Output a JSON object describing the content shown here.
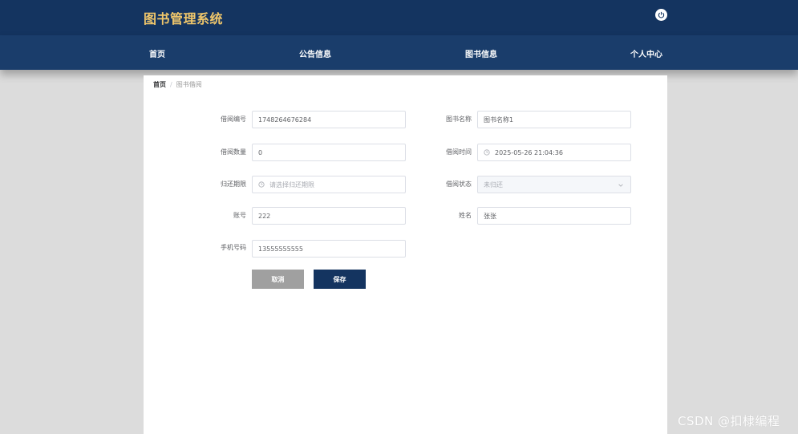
{
  "header": {
    "app_title": "图书管理系统"
  },
  "nav": {
    "items": [
      {
        "label": "首页"
      },
      {
        "label": "公告信息"
      },
      {
        "label": "图书信息"
      },
      {
        "label": "个人中心"
      }
    ]
  },
  "breadcrumb": {
    "home": "首页",
    "separator": "/",
    "current": "图书借阅"
  },
  "form": {
    "borrow_no": {
      "label": "借阅编号",
      "value": "1748264676284"
    },
    "book_name": {
      "label": "图书名称",
      "value": "图书名称1"
    },
    "borrow_qty": {
      "label": "借阅数量",
      "value": "0"
    },
    "borrow_time": {
      "label": "借阅时间",
      "value": "2025-05-26 21:04:36"
    },
    "return_deadline": {
      "label": "归还期限",
      "placeholder": "请选择归还期限"
    },
    "borrow_status": {
      "label": "借阅状态",
      "value": "未归还"
    },
    "account": {
      "label": "账号",
      "value": "222"
    },
    "name": {
      "label": "姓名",
      "value": "张张"
    },
    "phone": {
      "label": "手机号码",
      "value": "13555555555"
    }
  },
  "buttons": {
    "cancel": "取消",
    "save": "保存"
  },
  "watermark": "CSDN @扣棣编程",
  "colors": {
    "header_bg": "#143460",
    "nav_bg": "#1a3d6b",
    "title_gold": "#f0c76b",
    "save_button": "#143460",
    "cancel_button": "#a0a0a0"
  }
}
